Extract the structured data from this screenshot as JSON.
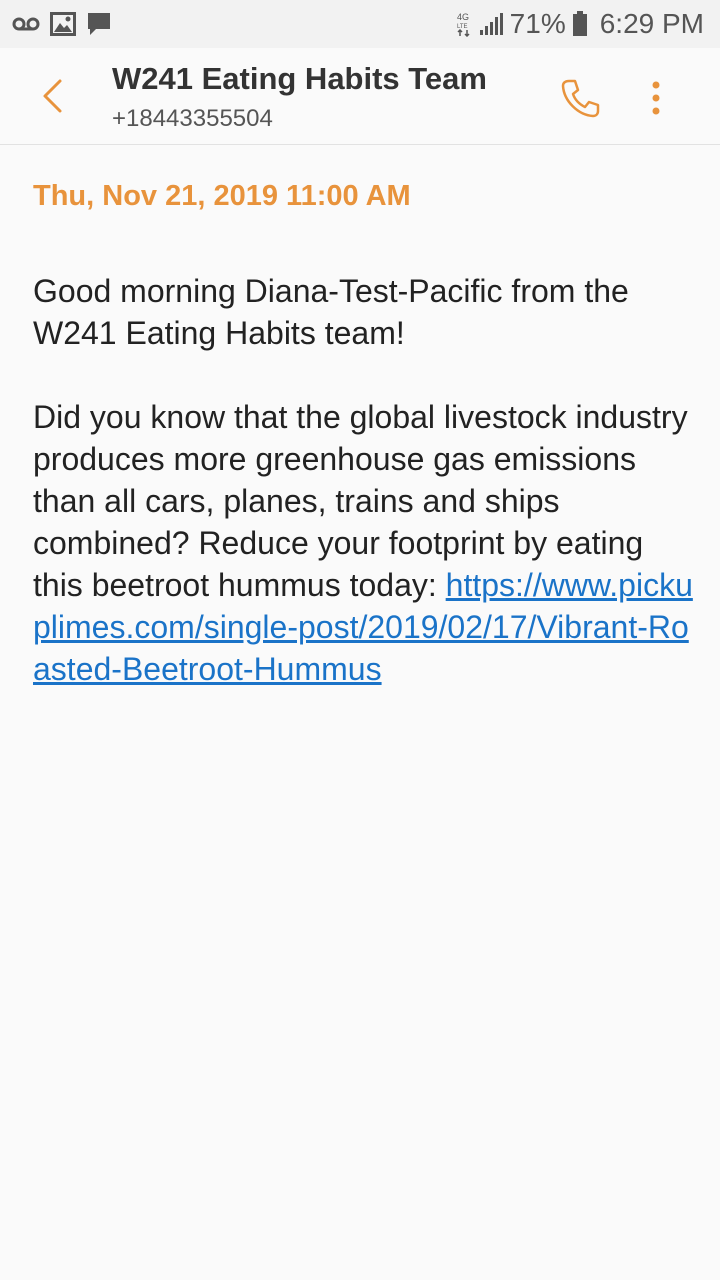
{
  "status_bar": {
    "battery_percent": "71%",
    "time": "6:29 PM",
    "icons": [
      "voicemail-icon",
      "image-icon",
      "message-icon",
      "data-4g-icon",
      "signal-icon",
      "battery-icon"
    ]
  },
  "header": {
    "contact_name": "W241 Eating Habits Team",
    "contact_number": "+18443355504",
    "icons": [
      "back-arrow-icon",
      "phone-icon",
      "more-vert-icon"
    ]
  },
  "conversation": {
    "date": "Thu, Nov 21, 2019 11:00 AM",
    "message": {
      "greeting": "Good morning Diana-Test-Pacific from the W241 Eating Habits team!",
      "body": "Did you know that the global livestock industry produces more greenhouse gas emissions than all cars, planes, trains and ships combined? Reduce your footprint by eating this beetroot hummus today: ",
      "link": "https://www.pickuplimes.com/single-post/2019/02/17/Vibrant-Roasted-Beetroot-Hummus"
    }
  },
  "colors": {
    "accent": "#e8933c",
    "link": "#1a73c8",
    "background": "#fafafa"
  }
}
